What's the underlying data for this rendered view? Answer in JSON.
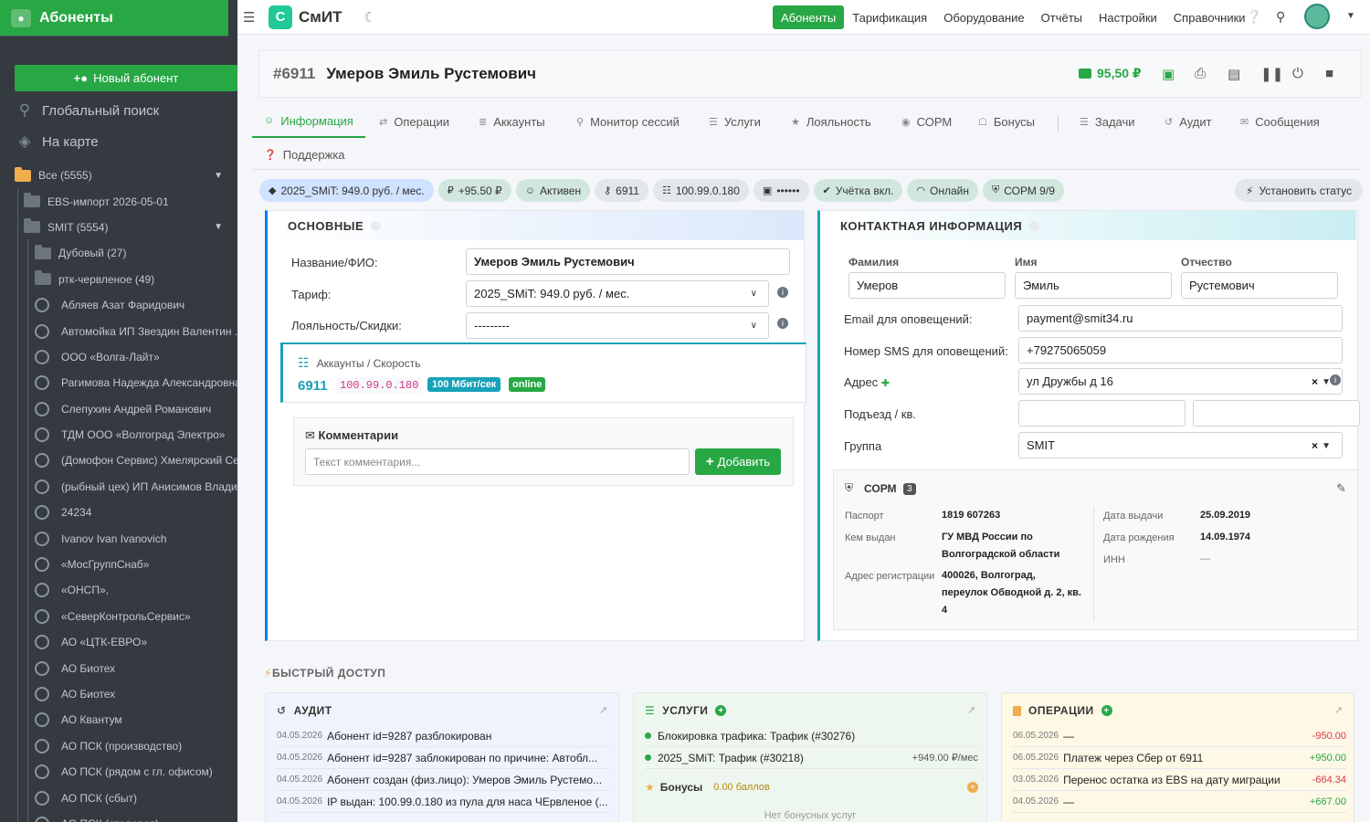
{
  "sidebar": {
    "title": "Абоненты",
    "new_button": "Новый абонент",
    "links": [
      "Глобальный поиск",
      "На карте"
    ],
    "tree": [
      {
        "label": "Все (5555)",
        "kind": "folder",
        "level": 0
      },
      {
        "label": "EBS-импорт 2026-05-01",
        "kind": "folder",
        "level": 1
      },
      {
        "label": "SMIT (5554)",
        "kind": "folder",
        "level": 1
      },
      {
        "label": "Дубовый (27)",
        "kind": "folder",
        "level": 2
      },
      {
        "label": "ртк-червленое (49)",
        "kind": "folder",
        "level": 2
      },
      {
        "label": "Абляев Азат Фаридович",
        "kind": "item",
        "level": 2
      },
      {
        "label": "Автомойка ИП Звездин Валентин ...",
        "kind": "item",
        "level": 2
      },
      {
        "label": "ООО «Волга-Лайт»",
        "kind": "item",
        "level": 2
      },
      {
        "label": "Рагимова Надежда Александровна",
        "kind": "item",
        "level": 2
      },
      {
        "label": "Слепухин Андрей Романович",
        "kind": "item",
        "level": 2
      },
      {
        "label": "ТДМ ООО «Волгоград Электро»",
        "kind": "item",
        "level": 2
      },
      {
        "label": "(Домофон Сервис) Хмелярский Се...",
        "kind": "item",
        "level": 2
      },
      {
        "label": "(рыбный цех) ИП Анисимов Влади...",
        "kind": "item",
        "level": 2
      },
      {
        "label": "24234",
        "kind": "item",
        "level": 2
      },
      {
        "label": "Ivanov Ivan Ivanovich",
        "kind": "item",
        "level": 2
      },
      {
        "label": "«МосГруппСнаб»",
        "kind": "item",
        "level": 2
      },
      {
        "label": "«ОНСП»,",
        "kind": "item",
        "level": 2
      },
      {
        "label": "«СеверКонтрольСервис»",
        "kind": "item",
        "level": 2
      },
      {
        "label": "АО «ЦТК-ЕВРО»",
        "kind": "item",
        "level": 2
      },
      {
        "label": "АО Биотех",
        "kind": "item",
        "level": 2
      },
      {
        "label": "АО Биотех",
        "kind": "item",
        "level": 2
      },
      {
        "label": "АО Квантум",
        "kind": "item",
        "level": 2
      },
      {
        "label": "АО ПСК (производство)",
        "kind": "item",
        "level": 2
      },
      {
        "label": "АО ПСК (рядом с гл. офисом)",
        "kind": "item",
        "level": 2
      },
      {
        "label": "АО ПСК (сбыт)",
        "kind": "item",
        "level": 2
      },
      {
        "label": "АО ПСК (столовая)",
        "kind": "item",
        "level": 2
      }
    ]
  },
  "topbar": {
    "logo_letter": "С",
    "logo_text": "СмИТ",
    "nav": [
      "Абоненты",
      "Тарификация",
      "Оборудование",
      "Отчёты",
      "Настройки",
      "Справочники"
    ],
    "nav_active": 0
  },
  "header": {
    "id": "#6911",
    "name": "Умеров Эмиль Рустемович",
    "balance": "95,50 ₽"
  },
  "tabs": [
    "Информация",
    "Операции",
    "Аккаунты",
    "Монитор сессий",
    "Услуги",
    "Лояльность",
    "СОРМ",
    "Бонусы",
    "Задачи",
    "Аудит",
    "Сообщения",
    "Поддержка"
  ],
  "badges": [
    "2025_SMiT: 949.0 руб. / мес.",
    "+95.50 ₽",
    "Активен",
    "6911",
    "100.99.0.180",
    "••••••",
    "Учётка вкл.",
    "Онлайн",
    "СОРМ 9/9"
  ],
  "set_status": "Установить статус",
  "basic": {
    "title": "ОСНОВНЫЕ",
    "name_label": "Название/ФИО:",
    "name_value": "Умеров Эмиль Рустемович",
    "tariff_label": "Тариф:",
    "tariff_value": "2025_SMiT: 949.0 руб. / мес.",
    "loyalty_label": "Лояльность/Скидки:",
    "loyalty_value": "---------",
    "accounts_title": "Аккаунты / Скорость",
    "account_id": "6911",
    "account_ip": "100.99.0.180",
    "account_speed": "100 Мбит/сек",
    "account_status": "online",
    "comments_title": "Комментарии",
    "comment_placeholder": "Текст комментария...",
    "add_button": "Добавить"
  },
  "contact": {
    "title": "КОНТАКТНАЯ ИНФОРМАЦИЯ",
    "surname_label": "Фамилия",
    "surname": "Умеров",
    "firstname_label": "Имя",
    "firstname": "Эмиль",
    "patronymic_label": "Отчество",
    "patronymic": "Рустемович",
    "email_label": "Email для оповещений:",
    "email": "payment@smit34.ru",
    "sms_label": "Номер SMS для оповещений:",
    "sms": "+79275065059",
    "address_label": "Адрес",
    "address": "ул Дружбы д 16",
    "entrance_label": "Подъезд / кв.",
    "group_label": "Группа",
    "group": "SMIT"
  },
  "sorm": {
    "title": "СОРМ",
    "count": "3",
    "passport_label": "Паспорт",
    "passport": "1819 607263",
    "issued_by_label": "Кем выдан",
    "issued_by": [
      "ГУ МВД России по",
      "Волгоградской области"
    ],
    "reg_address_label": "Адрес регистрации",
    "reg_address": [
      "400026, Волгоград,",
      "переулок Обводной д. 2, кв.",
      "4"
    ],
    "issue_date_label": "Дата выдачи",
    "issue_date": "25.09.2019",
    "birth_date_label": "Дата рождения",
    "birth_date": "14.09.1974",
    "inn_label": "ИНН",
    "inn": "—"
  },
  "quick": {
    "title": "БЫСТРЫЙ ДОСТУП",
    "audit": {
      "title": "АУДИТ",
      "rows": [
        {
          "date": "04.05.2026",
          "text": "Абонент id=9287 разблокирован"
        },
        {
          "date": "04.05.2026",
          "text": "Абонент id=9287 заблокирован по причине: Автобл..."
        },
        {
          "date": "04.05.2026",
          "text": "Абонент создан (физ.лицо): Умеров Эмиль Рустемо..."
        },
        {
          "date": "04.05.2026",
          "text": "IP выдан: 100.99.0.180 из пула для наса ЧЕрвленое (..."
        }
      ]
    },
    "services": {
      "title": "УСЛУГИ",
      "rows": [
        {
          "text": "Блокировка трафика: Трафик (#30276)",
          "amount": ""
        },
        {
          "text": "2025_SMiT: Трафик (#30218)",
          "amount": "+949.00 ₽/мес"
        }
      ],
      "bonus_label": "Бонусы",
      "bonus_value": "0.00 баллов",
      "no_bonus": "Нет бонусных услуг"
    },
    "operations": {
      "title": "ОПЕРАЦИИ",
      "rows": [
        {
          "date": "06.05.2026",
          "text": "—",
          "amount": "-950.00",
          "neg": true
        },
        {
          "date": "06.05.2026",
          "text": "Платеж через Сбер от 6911",
          "amount": "+950.00",
          "neg": false
        },
        {
          "date": "03.05.2026",
          "text": "Перенос остатка из EBS на дату миграции",
          "amount": "-664.34",
          "neg": true
        },
        {
          "date": "04.05.2026",
          "text": "—",
          "amount": "+667.00",
          "neg": false
        }
      ]
    }
  }
}
